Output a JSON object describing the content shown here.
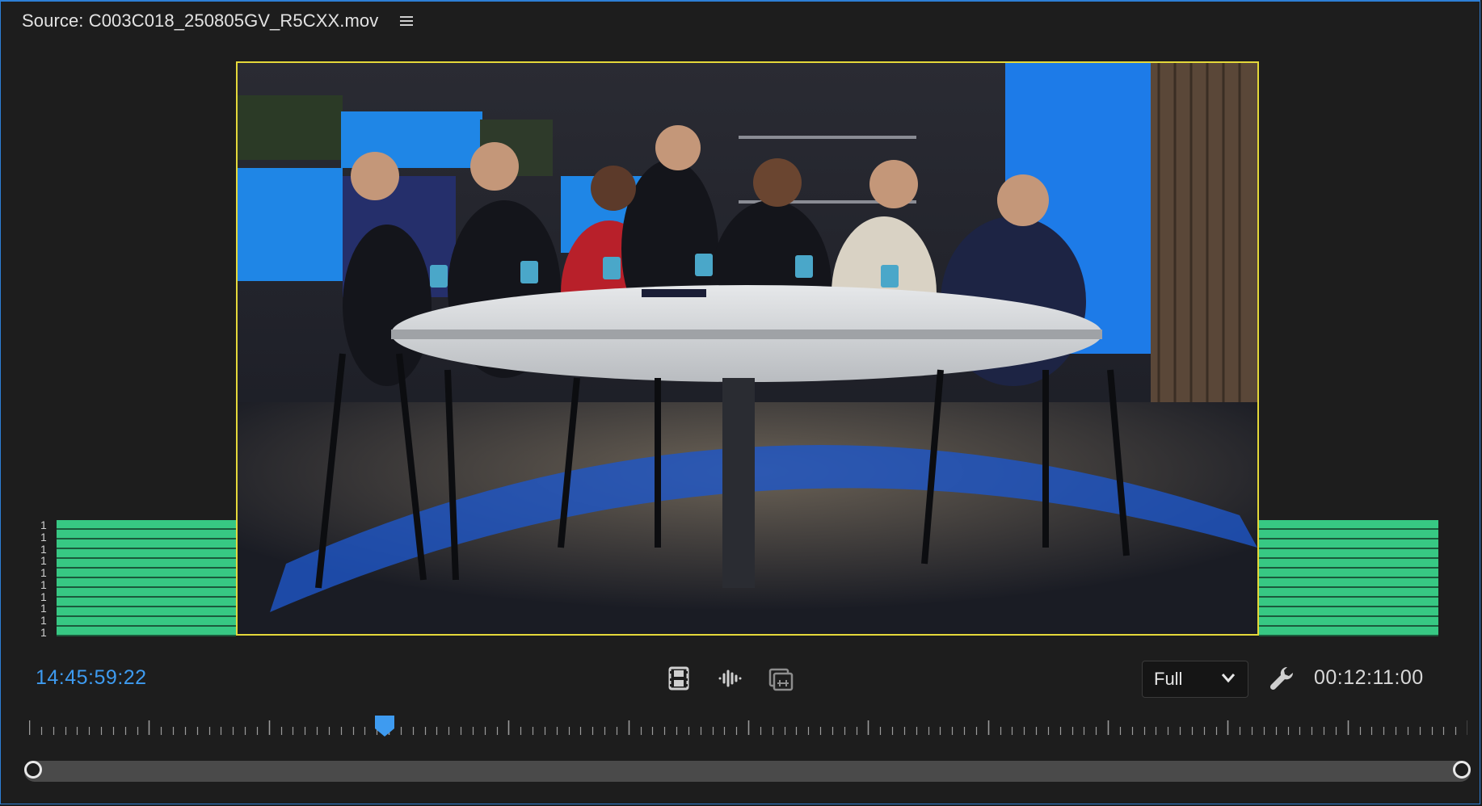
{
  "panel": {
    "title": "Source: C003C018_250805GV_R5CXX.mov",
    "menu_icon": "hamburger-menu-icon"
  },
  "audio_meter": {
    "channel_labels": [
      "1",
      "1",
      "1",
      "1",
      "1",
      "1",
      "1",
      "1",
      "1",
      "1"
    ],
    "color": "#37c883"
  },
  "playback": {
    "current_timecode": "14:45:59:22",
    "duration_timecode": "00:12:11:00",
    "zoom": "Full",
    "playhead_position": 0.247
  },
  "controls": {
    "video_only_icon": "film-strip-icon",
    "audio_only_icon": "audio-waveform-icon",
    "export_frame_icon": "insert-clip-icon",
    "settings_icon": "wrench-icon",
    "zoom_dropdown_icon": "chevron-down-icon"
  },
  "colors": {
    "accent": "#3e9bf0",
    "viewer_border": "#e4d83a",
    "panel_border": "#2d7fd6"
  }
}
